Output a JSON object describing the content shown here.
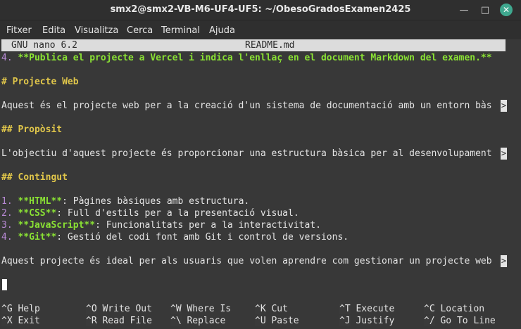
{
  "window": {
    "title": "smx2@smx2-VB-M6-UF4-UF5: ~/ObesoGradosExamen2425",
    "minimize_glyph": "—",
    "maximize_glyph": "□",
    "close_glyph": "✕"
  },
  "menu": [
    "Fitxer",
    "Edita",
    "Visualitza",
    "Cerca",
    "Terminal",
    "Ajuda"
  ],
  "nano": {
    "version": "GNU nano 6.2",
    "filename": "README.md"
  },
  "content": {
    "line1_num": "4.",
    "line1_text": " **Publica el projecte a Vercel i indica l'enllaç en el document Markdown del examen.**",
    "heading1": "# Projecte Web",
    "para1": "Aquest és el projecte web per a la creació d'un sistema de documentació amb un entorn bàs",
    "heading2": "## Propòsit",
    "para2": "L'objectiu d'aquest projecte és proporcionar una estructura bàsica per al desenvolupament",
    "heading3": "## Contingut",
    "list": [
      {
        "num": "1.",
        "bold": " **HTML**",
        "rest": ": Pàgines bàsiques amb estructura."
      },
      {
        "num": "2.",
        "bold": " **CSS**",
        "rest": ": Full d'estils per a la presentació visual."
      },
      {
        "num": "3.",
        "bold": " **JavaScript**",
        "rest": ": Funcionalitats per a la interactivitat."
      },
      {
        "num": "4.",
        "bold": " **Git**",
        "rest": ": Gestió del codi font amb Git i control de versions."
      }
    ],
    "para3": "Aquest projecte és ideal per als usuaris que volen aprendre com gestionar un projecte web",
    "overflow_marker": ">"
  },
  "shortcuts": [
    {
      "key": "^G",
      "label": "Help"
    },
    {
      "key": "^O",
      "label": "Write Out"
    },
    {
      "key": "^W",
      "label": "Where Is"
    },
    {
      "key": "^K",
      "label": "Cut"
    },
    {
      "key": "^T",
      "label": "Execute"
    },
    {
      "key": "^C",
      "label": "Location"
    },
    {
      "key": "^X",
      "label": "Exit"
    },
    {
      "key": "^R",
      "label": "Read File"
    },
    {
      "key": "^\\",
      "label": "Replace"
    },
    {
      "key": "^U",
      "label": "Paste"
    },
    {
      "key": "^J",
      "label": "Justify"
    },
    {
      "key": "^/",
      "label": "Go To Line"
    }
  ]
}
